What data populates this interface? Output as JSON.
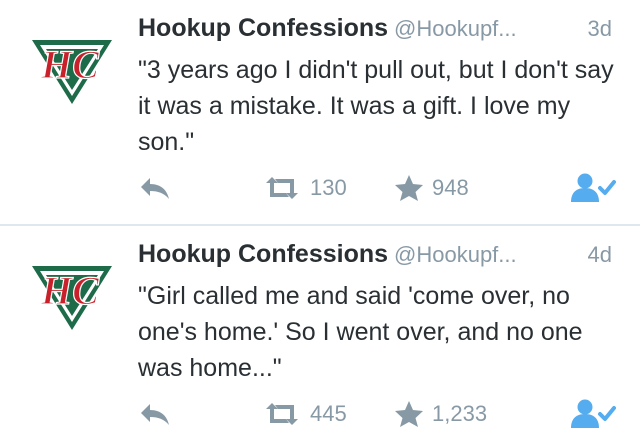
{
  "tweets": [
    {
      "author_name": "Hookup Confessions",
      "handle": "@Hookupf...",
      "time": "3d",
      "text": "\"3 years ago I didn't pull out, but I don't say it was a mistake. It was a gift. I love my son.\"",
      "retweets": "130",
      "favorites": "948",
      "avatar_monogram": "HC"
    },
    {
      "author_name": "Hookup Confessions",
      "handle": "@Hookupf...",
      "time": "4d",
      "text": "\"Girl called me and said 'come over, no one's home.' So I went over, and no one was home...\"",
      "retweets": "445",
      "favorites": "1,233",
      "avatar_monogram": "HC"
    }
  ],
  "icons": {
    "reply": "reply-arrow-icon",
    "retweet": "retweet-icon",
    "favorite": "star-icon",
    "follow": "follow-user-icon"
  },
  "colors": {
    "accent": "#55acee",
    "muted": "#8899a6",
    "text": "#292f33",
    "logo_green": "#1e6b4a",
    "logo_red": "#c8212b"
  }
}
